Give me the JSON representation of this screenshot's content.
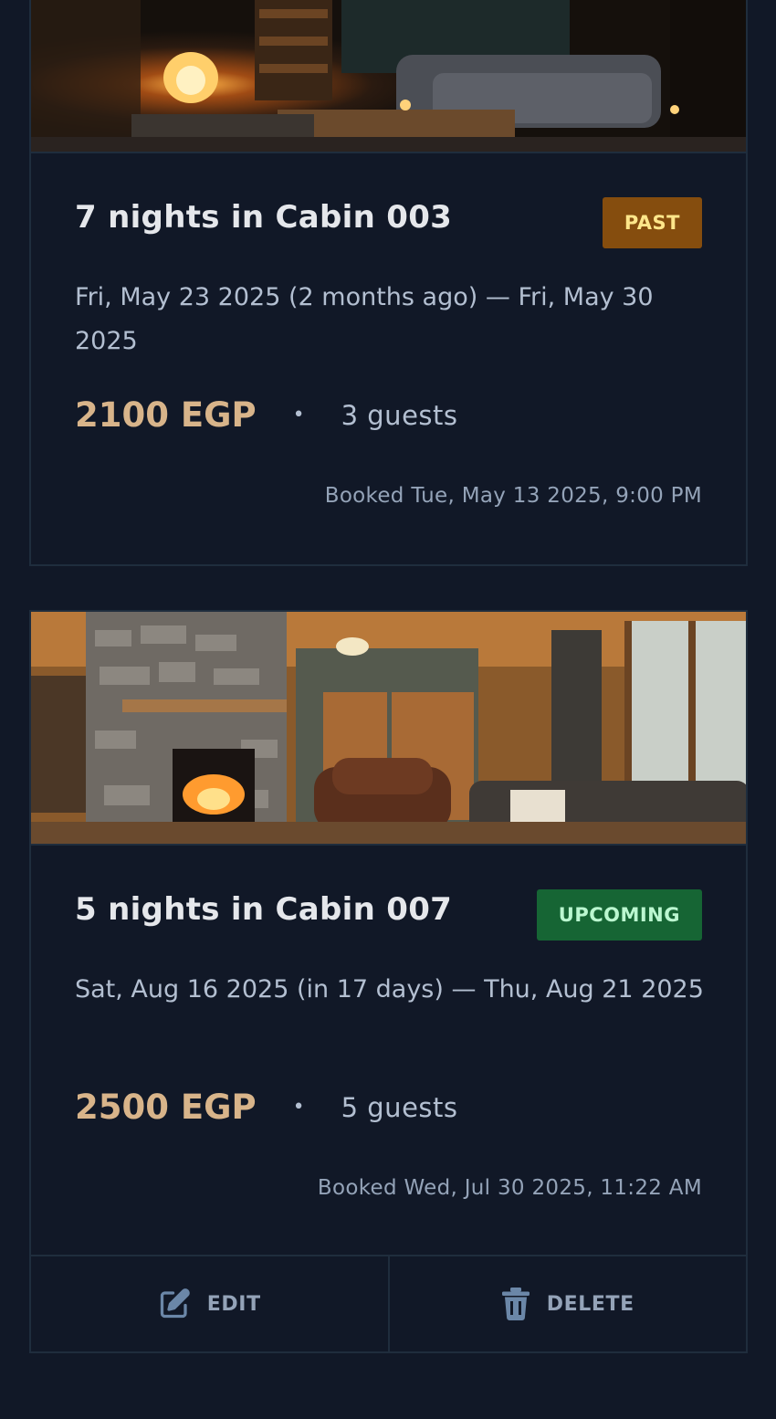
{
  "bookings": [
    {
      "title": "7 nights in Cabin 003",
      "status": "past",
      "status_label": "PAST",
      "status_bg": "#854d0e",
      "status_fg": "#fde68a",
      "dates": "Fri, May 23 2025 (2 months ago) — Fri, May 30 2025",
      "price": "2100 EGP",
      "separator": "•",
      "guests": "3 guests",
      "booked": "Booked Tue, May 13 2025, 9:00 PM"
    },
    {
      "title": "5 nights in Cabin 007",
      "status": "upcoming",
      "status_label": "UPCOMING",
      "status_bg": "#166534",
      "status_fg": "#bbf7d0",
      "dates": "Sat, Aug 16 2025 (in 17 days) — Thu, Aug 21 2025",
      "price": "2500 EGP",
      "separator": "•",
      "guests": "5 guests",
      "booked": "Booked Wed, Jul 30 2025, 11:22 AM",
      "actions": {
        "edit_label": "EDIT",
        "edit_icon": "pencil-square-icon",
        "delete_label": "DELETE",
        "delete_icon": "trash-icon"
      }
    }
  ],
  "colors": {
    "background": "#111827",
    "border": "#1f2d3d",
    "price": "#d8b48a",
    "muted": "#94a3b8"
  }
}
